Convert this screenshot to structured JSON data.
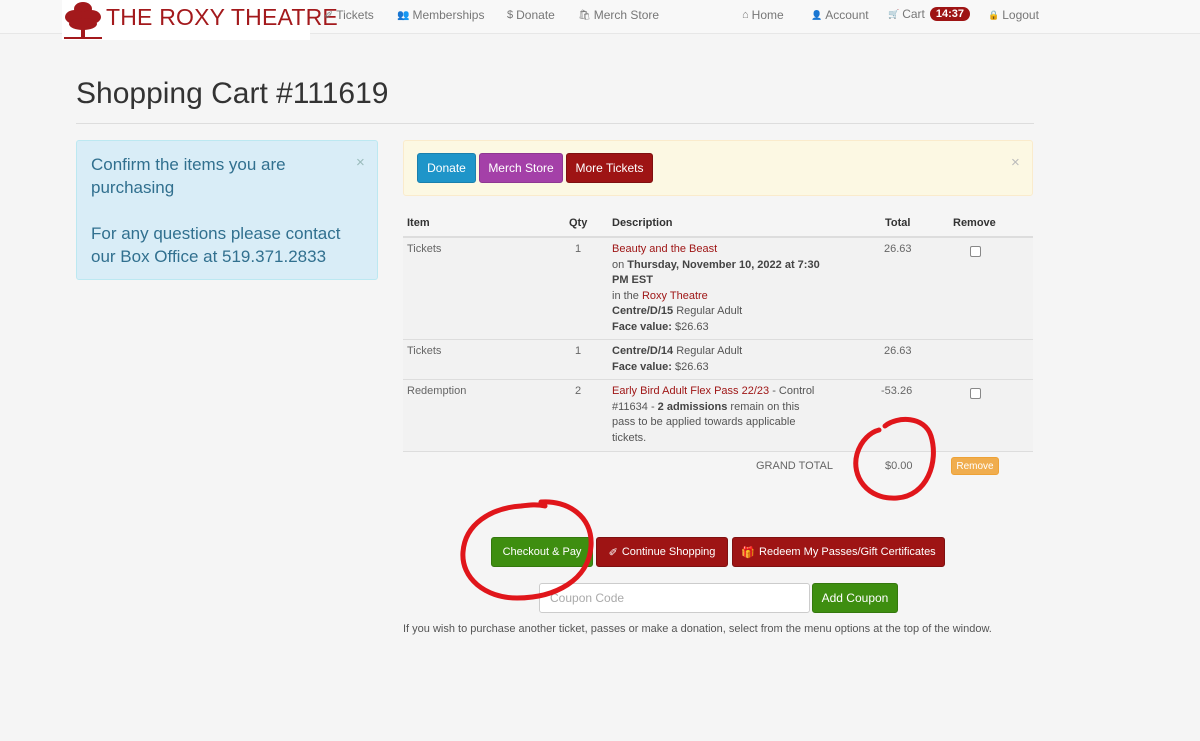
{
  "brand": {
    "name": "THE ROXY THEATRE",
    "logo_icon": "tree-logo-icon",
    "color": "#a3191c"
  },
  "nav": {
    "left": [
      {
        "label": "Tickets",
        "icon": "ticket-icon",
        "glyph": "✐"
      },
      {
        "label": "Memberships",
        "icon": "users-icon",
        "glyph": "👥"
      },
      {
        "label": "Donate",
        "icon": "dollar-icon",
        "glyph": "$"
      },
      {
        "label": "Merch Store",
        "icon": "shopping-bag-icon",
        "glyph": "🛍"
      }
    ],
    "right": [
      {
        "label": "Home",
        "icon": "home-icon",
        "glyph": "⌂"
      },
      {
        "label": "Account",
        "icon": "user-icon",
        "glyph": "👤"
      },
      {
        "label": "Cart",
        "icon": "cart-icon",
        "glyph": "🛒",
        "badge": "14:37"
      },
      {
        "label": "Logout",
        "icon": "lock-icon",
        "glyph": "🔒"
      }
    ]
  },
  "page": {
    "title": "Shopping Cart #111619"
  },
  "info_alert": {
    "line1": "Confirm the items you are purchasing",
    "line2": "For any questions please contact our Box Office at 519.371.2833",
    "close": "×"
  },
  "action_bar": {
    "donate": "Donate",
    "merch": "Merch Store",
    "more_tickets": "More Tickets",
    "close": "×"
  },
  "table": {
    "headers": {
      "item": "Item",
      "qty": "Qty",
      "description": "Description",
      "total": "Total",
      "remove": "Remove"
    },
    "rows": [
      {
        "item": "Tickets",
        "qty": "1",
        "show": "Beauty and the Beast",
        "on": "on ",
        "date": "Thursday, November 10, 2022 at 7:30 PM EST",
        "in": "in the ",
        "venue": "Roxy Theatre",
        "seat": "Centre/D/15",
        "seat_type": " Regular Adult",
        "face_label": "Face value:",
        "face_value": " $26.63",
        "total": "26.63",
        "removable": true
      },
      {
        "item": "Tickets",
        "qty": "1",
        "seat": "Centre/D/14",
        "seat_type": " Regular Adult",
        "face_label": "Face value:",
        "face_value": " $26.63",
        "total": "26.63",
        "removable": false
      },
      {
        "item": "Redemption",
        "qty": "2",
        "pass": "Early Bird Adult Flex Pass 22/23",
        "control": " - Control #11634 - ",
        "admissions": "2 admissions",
        "remain": " remain on this pass to be applied towards applicable tickets.",
        "total": "-53.26",
        "removable": true
      }
    ],
    "grand_total_label": "GRAND TOTAL",
    "grand_total": "$0.00",
    "remove_button": "Remove"
  },
  "buttons": {
    "checkout": "Checkout & Pay",
    "continue": "Continue Shopping",
    "redeem": "Redeem My Passes/Gift Certificates",
    "add_coupon": "Add Coupon"
  },
  "coupon": {
    "placeholder": "Coupon Code"
  },
  "footnote": "If you wish to purchase another ticket, passes or make a donation, select from the menu options at the top of the window.",
  "colors": {
    "red": "#9e1414",
    "green": "#3e8e10",
    "annotation": "#e0161b"
  }
}
